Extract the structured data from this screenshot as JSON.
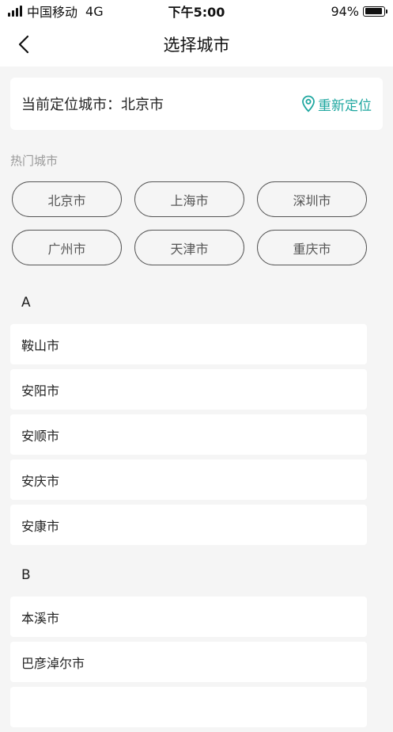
{
  "status_bar": {
    "carrier": "中国移动",
    "network": "4G",
    "time": "下午5:00",
    "battery_percent": "94%",
    "battery_level": 0.94
  },
  "nav": {
    "title": "选择城市",
    "back_icon": "chevron-left-icon"
  },
  "location": {
    "label": "当前定位城市：北京市",
    "relocate_label": "重新定位",
    "relocate_icon": "map-pin-icon",
    "accent_color": "#1fa7a0"
  },
  "hot_cities": {
    "title": "热门城市",
    "items": [
      "北京市",
      "上海市",
      "深圳市",
      "广州市",
      "天津市",
      "重庆市"
    ]
  },
  "sections": [
    {
      "letter": "A",
      "cities": [
        "鞍山市",
        "安阳市",
        "安顺市",
        "安庆市",
        "安康市"
      ]
    },
    {
      "letter": "B",
      "cities": [
        "本溪市",
        "巴彦淖尔市"
      ]
    }
  ]
}
